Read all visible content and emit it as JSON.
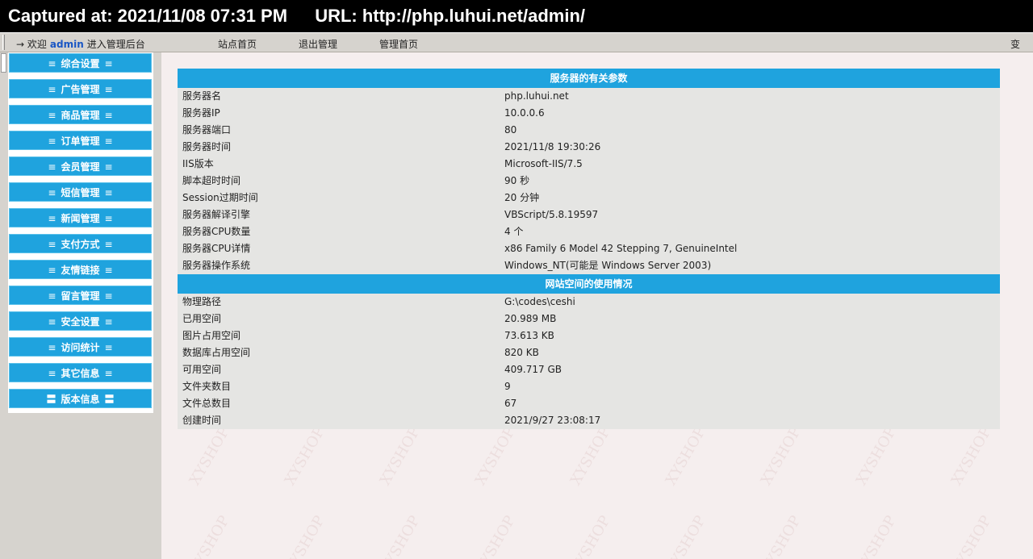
{
  "capture": {
    "captured_at": "Captured at: 2021/11/08 07:31 PM",
    "url": "URL: http://php.luhui.net/admin/"
  },
  "topbar": {
    "arrow": "→",
    "welcome_prefix": "欢迎",
    "user": "admin",
    "welcome_suffix": "进入管理后台",
    "links": [
      "站点首页",
      "退出管理",
      "管理首页"
    ],
    "switch_label": "变"
  },
  "sidebar": {
    "items": [
      "综合设置",
      "广告管理",
      "商品管理",
      "订单管理",
      "会员管理",
      "短信管理",
      "新闻管理",
      "支付方式",
      "友情链接",
      "留言管理",
      "安全设置",
      "访问统计",
      "其它信息",
      "版本信息"
    ],
    "bar_glyph": "≡",
    "active_glyph": "〓"
  },
  "server": {
    "title": "服务器的有关参数",
    "rows": [
      {
        "k": "服务器名",
        "v": "php.luhui.net"
      },
      {
        "k": "服务器IP",
        "v": "10.0.0.6"
      },
      {
        "k": "服务器端口",
        "v": "80"
      },
      {
        "k": "服务器时间",
        "v": "2021/11/8 19:30:26"
      },
      {
        "k": "IIS版本",
        "v": "Microsoft-IIS/7.5"
      },
      {
        "k": "脚本超时时间",
        "v": "90 秒"
      },
      {
        "k": "Session过期时间",
        "v": "20 分钟"
      },
      {
        "k": "服务器解译引擎",
        "v": "VBScript/5.8.19597"
      },
      {
        "k": "服务器CPU数量",
        "v": "4 个"
      },
      {
        "k": "服务器CPU详情",
        "v": "x86 Family 6 Model 42 Stepping 7, GenuineIntel"
      },
      {
        "k": "服务器操作系统",
        "v": "Windows_NT(可能是 Windows Server 2003)"
      }
    ]
  },
  "space": {
    "title": "网站空间的使用情况",
    "rows": [
      {
        "k": "物理路径",
        "v": "G:\\codes\\ceshi"
      },
      {
        "k": "已用空间",
        "v": "20.989 MB"
      },
      {
        "k": "图片占用空间",
        "v": "73.613 KB"
      },
      {
        "k": "数据库占用空间",
        "v": "820 KB"
      },
      {
        "k": "可用空间",
        "v": "409.717 GB"
      },
      {
        "k": "文件夹数目",
        "v": "9"
      },
      {
        "k": "文件总数目",
        "v": "67"
      },
      {
        "k": "创建时间",
        "v": "2021/9/27 23:08:17"
      }
    ]
  },
  "watermark": "XYSHOP",
  "colors": {
    "accent": "#1fa3de",
    "sidebar": "#d6d3ce",
    "content_bg": "#f5eeee",
    "panel_bg": "#e5e5e3"
  }
}
